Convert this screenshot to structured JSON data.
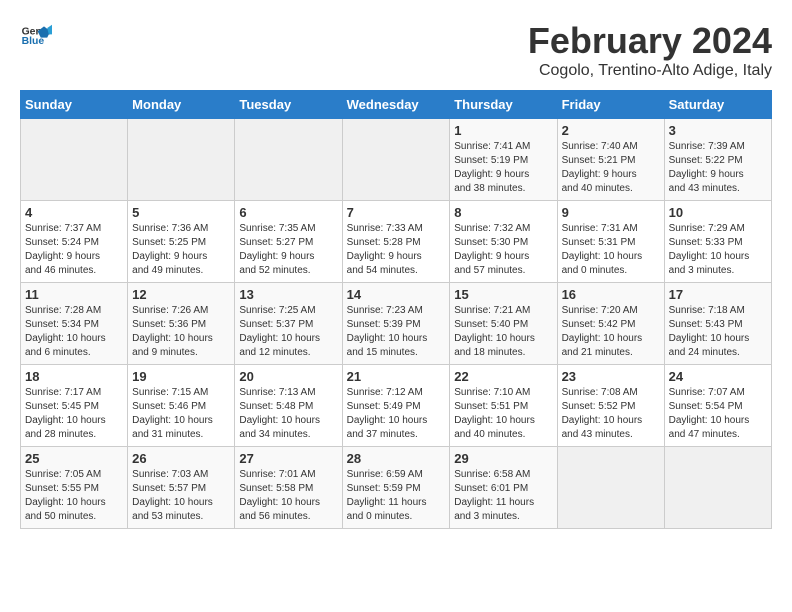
{
  "header": {
    "logo_general": "General",
    "logo_blue": "Blue",
    "title": "February 2024",
    "subtitle": "Cogolo, Trentino-Alto Adige, Italy"
  },
  "days_of_week": [
    "Sunday",
    "Monday",
    "Tuesday",
    "Wednesday",
    "Thursday",
    "Friday",
    "Saturday"
  ],
  "weeks": [
    [
      {
        "day": "",
        "info": ""
      },
      {
        "day": "",
        "info": ""
      },
      {
        "day": "",
        "info": ""
      },
      {
        "day": "",
        "info": ""
      },
      {
        "day": "1",
        "info": "Sunrise: 7:41 AM\nSunset: 5:19 PM\nDaylight: 9 hours\nand 38 minutes."
      },
      {
        "day": "2",
        "info": "Sunrise: 7:40 AM\nSunset: 5:21 PM\nDaylight: 9 hours\nand 40 minutes."
      },
      {
        "day": "3",
        "info": "Sunrise: 7:39 AM\nSunset: 5:22 PM\nDaylight: 9 hours\nand 43 minutes."
      }
    ],
    [
      {
        "day": "4",
        "info": "Sunrise: 7:37 AM\nSunset: 5:24 PM\nDaylight: 9 hours\nand 46 minutes."
      },
      {
        "day": "5",
        "info": "Sunrise: 7:36 AM\nSunset: 5:25 PM\nDaylight: 9 hours\nand 49 minutes."
      },
      {
        "day": "6",
        "info": "Sunrise: 7:35 AM\nSunset: 5:27 PM\nDaylight: 9 hours\nand 52 minutes."
      },
      {
        "day": "7",
        "info": "Sunrise: 7:33 AM\nSunset: 5:28 PM\nDaylight: 9 hours\nand 54 minutes."
      },
      {
        "day": "8",
        "info": "Sunrise: 7:32 AM\nSunset: 5:30 PM\nDaylight: 9 hours\nand 57 minutes."
      },
      {
        "day": "9",
        "info": "Sunrise: 7:31 AM\nSunset: 5:31 PM\nDaylight: 10 hours\nand 0 minutes."
      },
      {
        "day": "10",
        "info": "Sunrise: 7:29 AM\nSunset: 5:33 PM\nDaylight: 10 hours\nand 3 minutes."
      }
    ],
    [
      {
        "day": "11",
        "info": "Sunrise: 7:28 AM\nSunset: 5:34 PM\nDaylight: 10 hours\nand 6 minutes."
      },
      {
        "day": "12",
        "info": "Sunrise: 7:26 AM\nSunset: 5:36 PM\nDaylight: 10 hours\nand 9 minutes."
      },
      {
        "day": "13",
        "info": "Sunrise: 7:25 AM\nSunset: 5:37 PM\nDaylight: 10 hours\nand 12 minutes."
      },
      {
        "day": "14",
        "info": "Sunrise: 7:23 AM\nSunset: 5:39 PM\nDaylight: 10 hours\nand 15 minutes."
      },
      {
        "day": "15",
        "info": "Sunrise: 7:21 AM\nSunset: 5:40 PM\nDaylight: 10 hours\nand 18 minutes."
      },
      {
        "day": "16",
        "info": "Sunrise: 7:20 AM\nSunset: 5:42 PM\nDaylight: 10 hours\nand 21 minutes."
      },
      {
        "day": "17",
        "info": "Sunrise: 7:18 AM\nSunset: 5:43 PM\nDaylight: 10 hours\nand 24 minutes."
      }
    ],
    [
      {
        "day": "18",
        "info": "Sunrise: 7:17 AM\nSunset: 5:45 PM\nDaylight: 10 hours\nand 28 minutes."
      },
      {
        "day": "19",
        "info": "Sunrise: 7:15 AM\nSunset: 5:46 PM\nDaylight: 10 hours\nand 31 minutes."
      },
      {
        "day": "20",
        "info": "Sunrise: 7:13 AM\nSunset: 5:48 PM\nDaylight: 10 hours\nand 34 minutes."
      },
      {
        "day": "21",
        "info": "Sunrise: 7:12 AM\nSunset: 5:49 PM\nDaylight: 10 hours\nand 37 minutes."
      },
      {
        "day": "22",
        "info": "Sunrise: 7:10 AM\nSunset: 5:51 PM\nDaylight: 10 hours\nand 40 minutes."
      },
      {
        "day": "23",
        "info": "Sunrise: 7:08 AM\nSunset: 5:52 PM\nDaylight: 10 hours\nand 43 minutes."
      },
      {
        "day": "24",
        "info": "Sunrise: 7:07 AM\nSunset: 5:54 PM\nDaylight: 10 hours\nand 47 minutes."
      }
    ],
    [
      {
        "day": "25",
        "info": "Sunrise: 7:05 AM\nSunset: 5:55 PM\nDaylight: 10 hours\nand 50 minutes."
      },
      {
        "day": "26",
        "info": "Sunrise: 7:03 AM\nSunset: 5:57 PM\nDaylight: 10 hours\nand 53 minutes."
      },
      {
        "day": "27",
        "info": "Sunrise: 7:01 AM\nSunset: 5:58 PM\nDaylight: 10 hours\nand 56 minutes."
      },
      {
        "day": "28",
        "info": "Sunrise: 6:59 AM\nSunset: 5:59 PM\nDaylight: 11 hours\nand 0 minutes."
      },
      {
        "day": "29",
        "info": "Sunrise: 6:58 AM\nSunset: 6:01 PM\nDaylight: 11 hours\nand 3 minutes."
      },
      {
        "day": "",
        "info": ""
      },
      {
        "day": "",
        "info": ""
      }
    ]
  ]
}
